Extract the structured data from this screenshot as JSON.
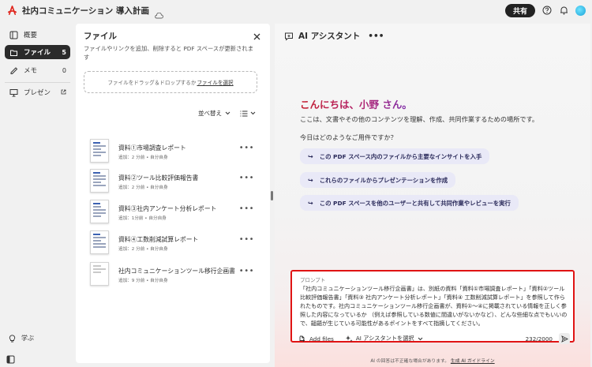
{
  "app": {
    "logo_glyph": "A",
    "document_title": "社内コミュニケーション 導入計画"
  },
  "header": {
    "share_label": "共有",
    "help_icon": "help-icon",
    "bell_icon": "bell-icon",
    "cloud_icon": "cloud-icon"
  },
  "sidebar": {
    "items": [
      {
        "label": "概要",
        "count": "",
        "icon": "overview-icon",
        "active": false
      },
      {
        "label": "ファイル",
        "count": "5",
        "icon": "file-icon",
        "active": true
      },
      {
        "label": "メモ",
        "count": "0",
        "icon": "memo-icon",
        "active": false
      },
      {
        "label": "プレゼン",
        "count": "",
        "icon": "presentation-icon",
        "active": false
      }
    ],
    "learn_label": "学ぶ"
  },
  "files_panel": {
    "title": "ファイル",
    "description": "ファイルやリンクを追加、削除すると PDF スペースが更新されます",
    "dropzone_text": "ファイルをドラッグ＆ドロップするか",
    "dropzone_link": "ファイルを選択",
    "sort_label": "並べ替え",
    "files": [
      {
        "name": "資料①市場調査レポート",
        "meta": "追加：2 分前 • 自分自身"
      },
      {
        "name": "資料②ツール比較評価報告書",
        "meta": "追加：2 分前 • 自分自身"
      },
      {
        "name": "資料③社内アンケート分析レポート",
        "meta": "追加：1分前 • 自分自身"
      },
      {
        "name": "資料④工数削減試算レポート",
        "meta": "追加：2 分前 • 自分自身"
      },
      {
        "name": "社内コミュニケーションツール移行企画書",
        "meta": "追加：9 分前 • 自分自身"
      }
    ]
  },
  "ai_panel": {
    "title": "AI アシスタント",
    "greeting": "こんにちは、小野 さん。",
    "intro": "ここは、文書やその他のコンテンツを理解、作成、共同作業するための場所です。",
    "question": "今日はどのようなご用件ですか？",
    "suggestions": [
      "この PDF スペース内のファイルから主要なインサイトを入手",
      "これらのファイルからプレゼンテーションを作成",
      "この PDF スペースを他のユーザーと共有して共同作業やレビューを実行"
    ],
    "prompt": {
      "label": "プロンプト",
      "text": "「社内コミュニケーションツール移行企画書」は、別紙の資料「資料①市場調査レポート」「資料②ツール比較評価報告書」「資料③ 社内アンケート分析レポート」「資料④ 工数削減試算レポート」を参照して作られたものです。社内コミュニケーションツール移行企画書が、資料①～④に掲載されている情報を正しく参照した内容になっているか （例えば参照している数値に間違いがないかなど）、どんな些細な点でもいいので、齟齬が生じている可能性があるポイントをすべて指摘してください。",
      "add_files_label": "Add files",
      "assistant_select_label": "AI アシスタントを選択",
      "char_count": "232/2000"
    },
    "disclaimer": "AI の回答は不正確な場合があります。",
    "disclaimer_link": "生成 AI ガイドライン"
  },
  "colors": {
    "accent_red": "#e01414",
    "greeting_start": "#c41f2f",
    "greeting_end": "#7a2fb0",
    "suggestion_bg": "#e9e9f7"
  }
}
